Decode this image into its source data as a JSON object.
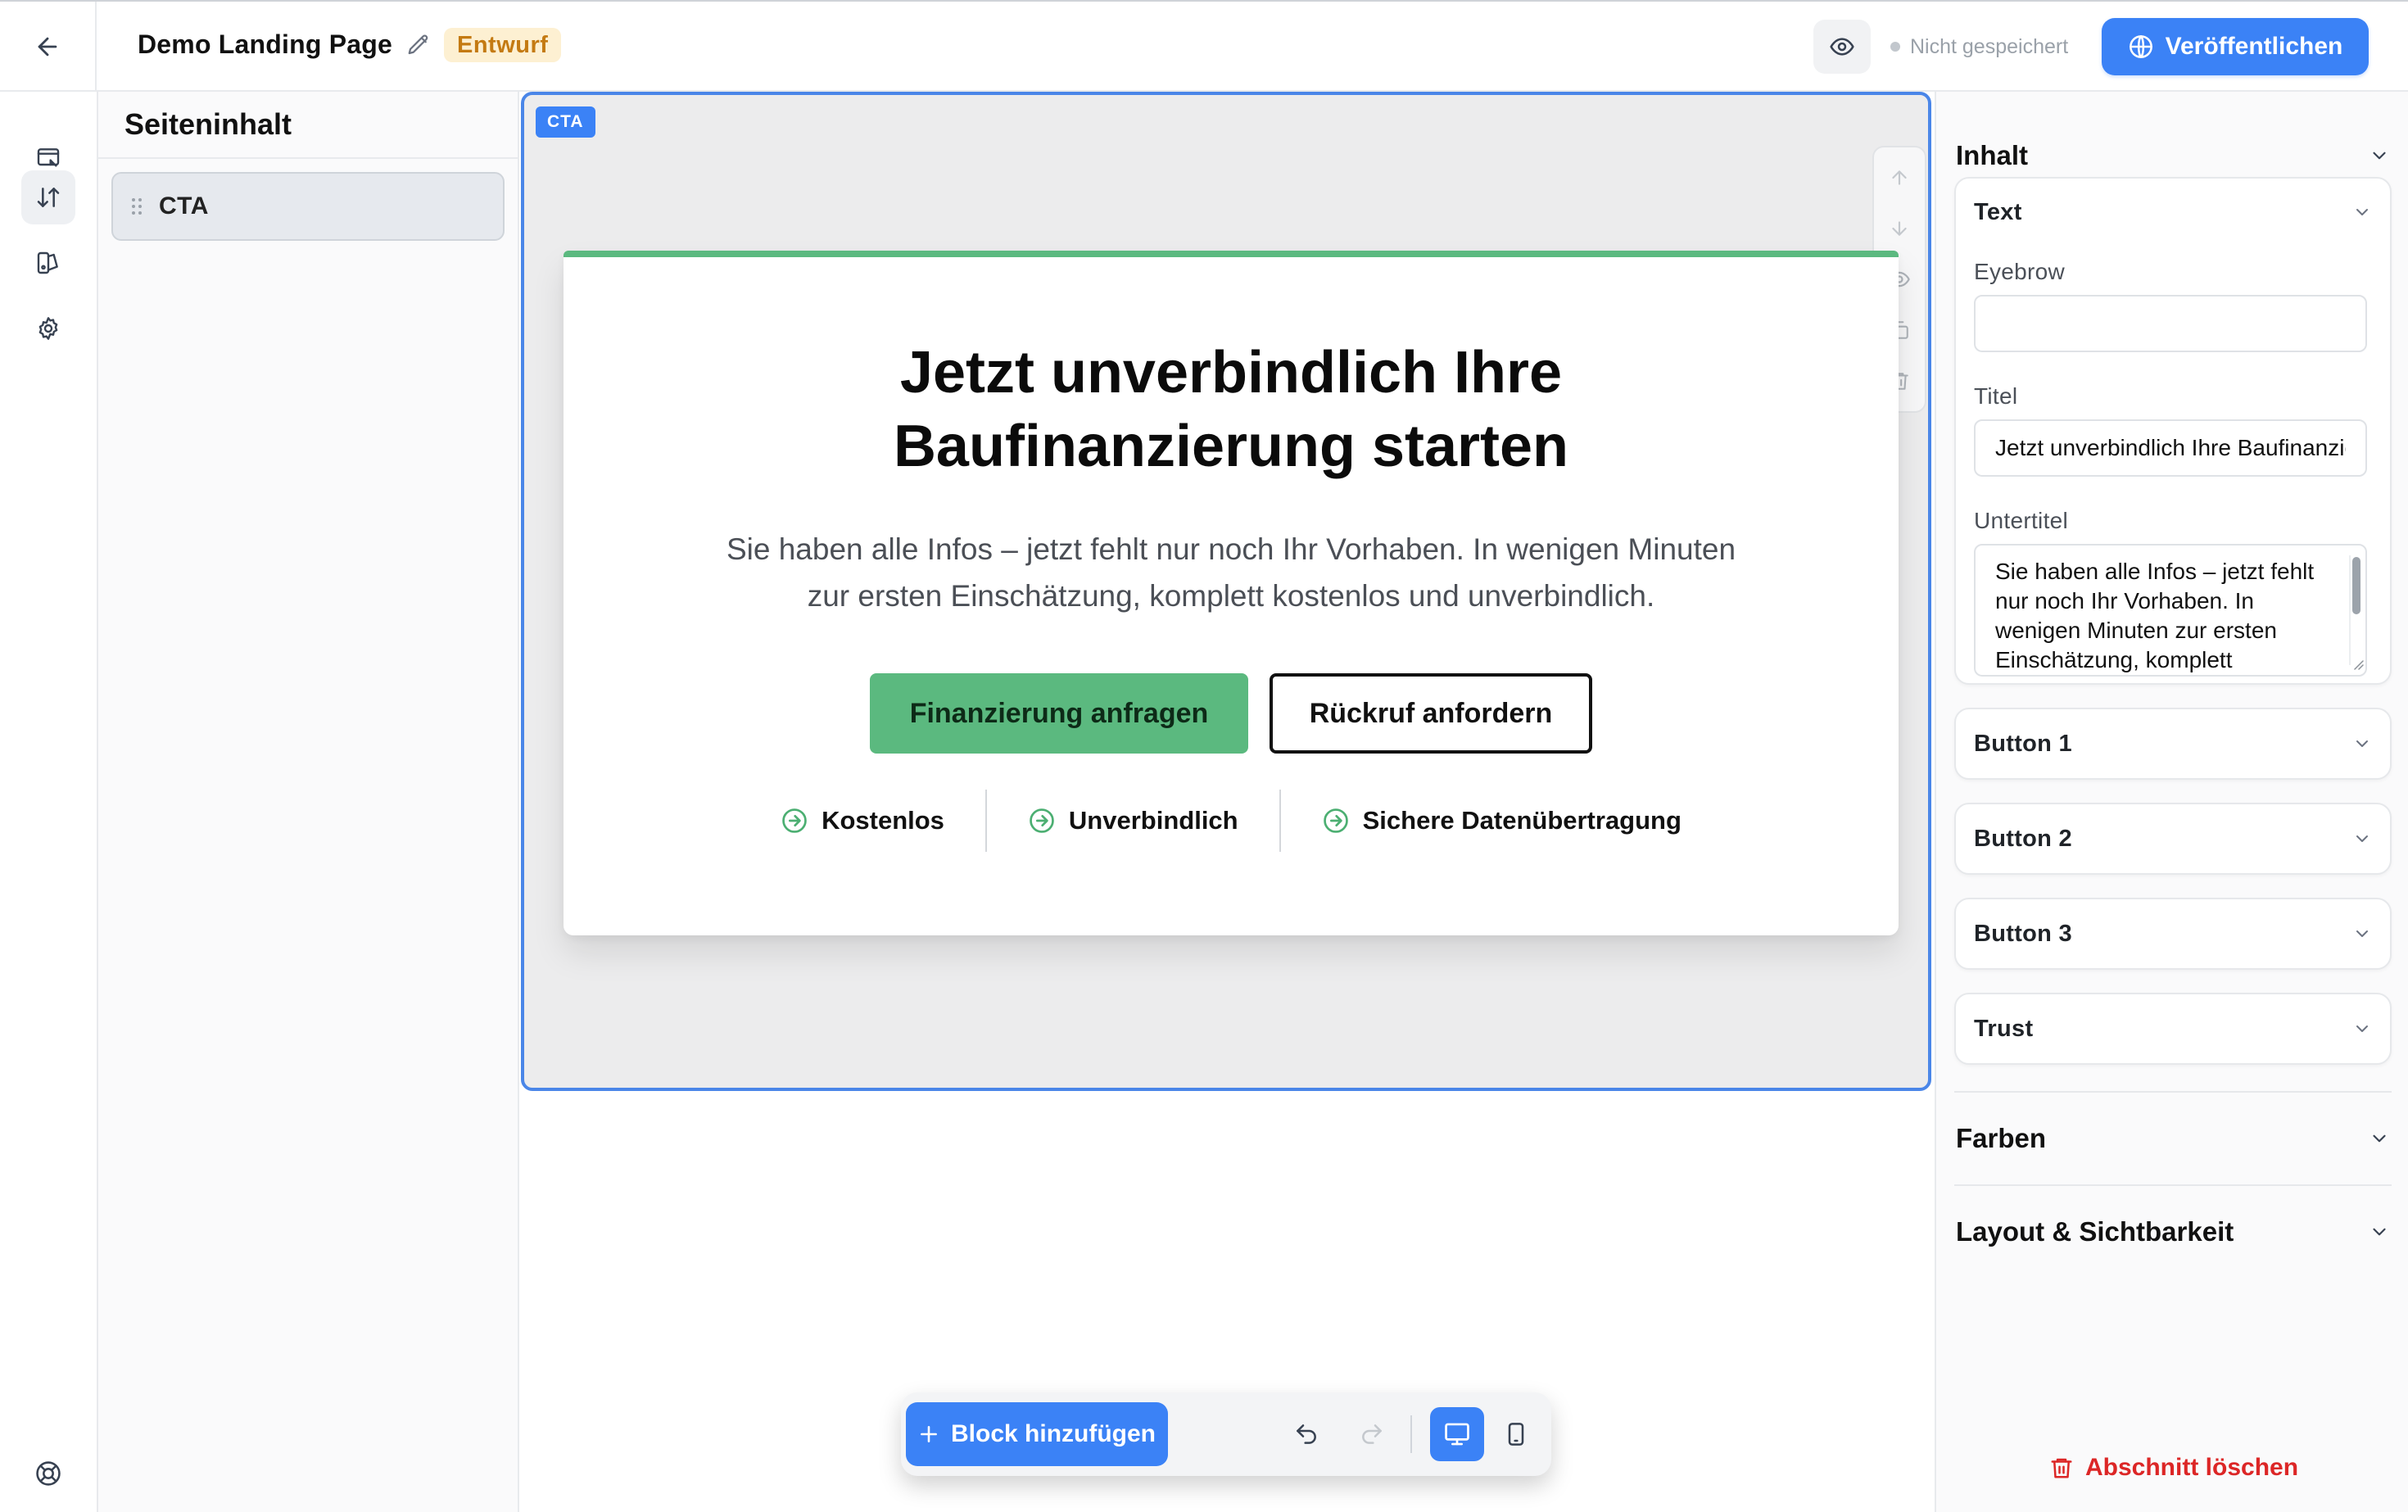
{
  "header": {
    "page_title": "Demo Landing Page",
    "status_badge": "Entwurf",
    "save_status": "Nicht gespeichert",
    "publish_label": "Veröffentlichen",
    "colors": {
      "accent": "#3b82f6",
      "badge_bg": "#fdf0d2",
      "badge_text": "#c47a12"
    }
  },
  "rail": {
    "items": [
      {
        "icon": "page-settings-icon",
        "active": false
      },
      {
        "icon": "sort-arrows-icon",
        "active": true
      },
      {
        "icon": "theme-icon",
        "active": false
      },
      {
        "icon": "gear-icon",
        "active": false
      }
    ],
    "bottom_icon": "help-lifebuoy-icon"
  },
  "structure": {
    "title": "Seiteninhalt",
    "blocks": [
      {
        "label": "CTA",
        "selected": true
      }
    ]
  },
  "canvas": {
    "section_tag": "CTA",
    "section_tools": [
      "arrow-up-icon",
      "arrow-down-icon",
      "eye-icon",
      "duplicate-icon",
      "trash-icon"
    ],
    "cta": {
      "title_line1": "Jetzt unverbindlich Ihre",
      "title_line2": "Baufinanzierung starten",
      "subtitle_line1": "Sie haben alle Infos – jetzt fehlt nur noch Ihr Vorhaben. In wenigen Minuten",
      "subtitle_line2": "zur ersten Einschätzung, komplett kostenlos und unverbindlich.",
      "primary_button": "Finanzierung anfragen",
      "secondary_button": "Rückruf anfordern",
      "trust_items": [
        "Kostenlos",
        "Unverbindlich",
        "Sichere Datenübertragung"
      ],
      "colors": {
        "primary": "#5bb97f",
        "card_top_border": "#5bb97f"
      }
    }
  },
  "bottom_toolbar": {
    "add_block_label": "Block hinzufügen",
    "undo_icon": "undo-icon",
    "redo_icon": "redo-icon",
    "view_modes": [
      {
        "icon": "desktop-icon",
        "active": true
      },
      {
        "icon": "mobile-icon",
        "active": false
      }
    ]
  },
  "inspector": {
    "content_section": "Inhalt",
    "text_group": {
      "title": "Text",
      "eyebrow_label": "Eyebrow",
      "eyebrow_value": "",
      "title_label": "Titel",
      "title_value": "Jetzt unverbindlich Ihre Baufinanzierung starten",
      "subtitle_label": "Untertitel",
      "subtitle_value": "Sie haben alle Infos – jetzt fehlt nur noch Ihr Vorhaben. In wenigen Minuten zur ersten Einschätzung, komplett kostenlos und unverbindlich."
    },
    "groups": [
      "Button 1",
      "Button 2",
      "Button 3",
      "Trust"
    ],
    "colors_section": "Farben",
    "layout_section": "Layout & Sichtbarkeit",
    "delete_label": "Abschnitt löschen"
  }
}
